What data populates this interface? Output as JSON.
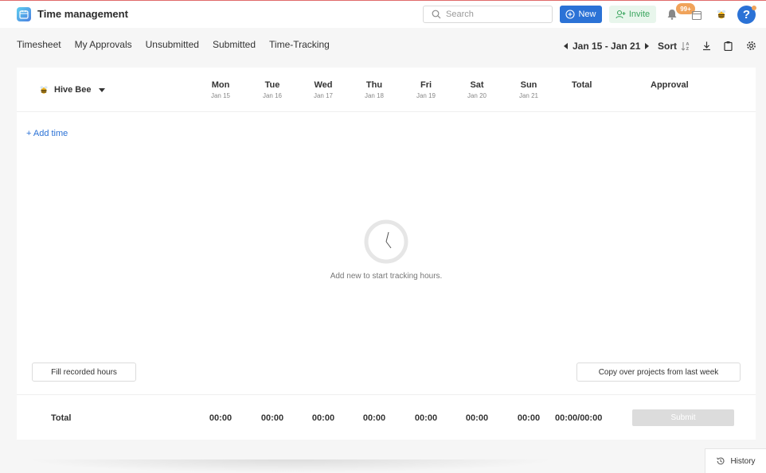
{
  "app": {
    "title": "Time management"
  },
  "header": {
    "search_placeholder": "Search",
    "new_label": "New",
    "invite_label": "Invite",
    "notification_count": "99+",
    "help_label": "?"
  },
  "tabs": [
    {
      "label": "Timesheet"
    },
    {
      "label": "My Approvals"
    },
    {
      "label": "Unsubmitted"
    },
    {
      "label": "Submitted"
    },
    {
      "label": "Time-Tracking"
    }
  ],
  "toolbar": {
    "date_range": "Jan 15 - Jan 21",
    "sort_label": "Sort"
  },
  "grid": {
    "user_name": "Hive Bee",
    "days": [
      {
        "day": "Mon",
        "date": "Jan 15"
      },
      {
        "day": "Tue",
        "date": "Jan 16"
      },
      {
        "day": "Wed",
        "date": "Jan 17"
      },
      {
        "day": "Thu",
        "date": "Jan 18"
      },
      {
        "day": "Fri",
        "date": "Jan 19"
      },
      {
        "day": "Sat",
        "date": "Jan 20"
      },
      {
        "day": "Sun",
        "date": "Jan 21"
      }
    ],
    "total_header": "Total",
    "approval_header": "Approval",
    "add_time_label": "+ Add time",
    "empty_message": "Add new to start tracking hours.",
    "fill_button": "Fill recorded hours",
    "copy_button": "Copy over projects from last week"
  },
  "footer": {
    "total_label": "Total",
    "day_totals": [
      "00:00",
      "00:00",
      "00:00",
      "00:00",
      "00:00",
      "00:00",
      "00:00"
    ],
    "grand_total": "00:00/00:00",
    "submit_label": "Submit"
  },
  "history_label": "History",
  "colors": {
    "primary": "#2b72d6",
    "invite_bg": "#e8f6ec",
    "invite_text": "#3aa55e",
    "badge": "#f0a35a",
    "submit_disabled": "#dcdcdc"
  }
}
